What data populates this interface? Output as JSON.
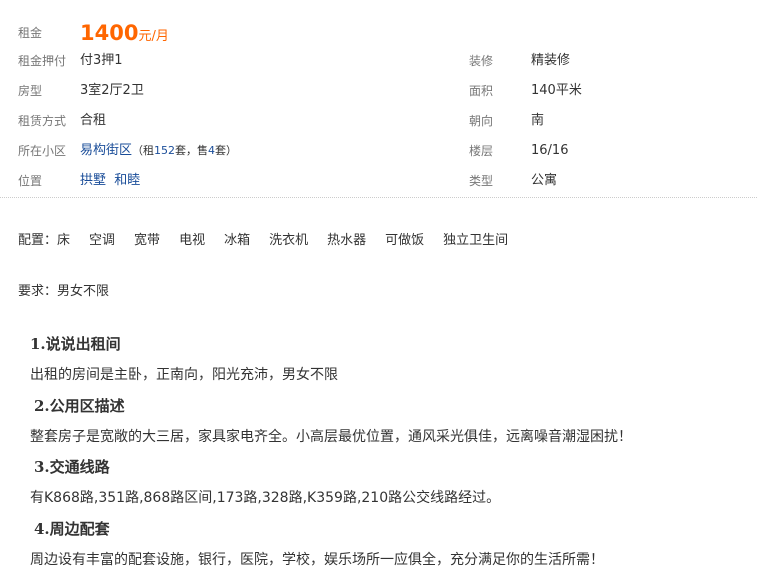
{
  "info": {
    "rent": {
      "label": "租金",
      "amount": "1400",
      "unit": "元/月"
    },
    "deposit": {
      "label": "租金押付",
      "value": "付3押1"
    },
    "decoration": {
      "label": "装修",
      "value": "精装修"
    },
    "layout": {
      "label": "房型",
      "value": "3室2厅2卫"
    },
    "area": {
      "label": "面积",
      "value": "140平米"
    },
    "rent_type": {
      "label": "租赁方式",
      "value": "合租"
    },
    "facing": {
      "label": "朝向",
      "value": "南"
    },
    "community": {
      "label": "所在小区",
      "name": "易构街区",
      "open": "（租",
      "rent_count": "152",
      "mid": "套，售",
      "sale_count": "4",
      "close": "套）"
    },
    "floor": {
      "label": "楼层",
      "value": "16/16"
    },
    "location": {
      "label": "位置",
      "district": "拱墅",
      "area": "和睦"
    },
    "type": {
      "label": "类型",
      "value": "公寓"
    }
  },
  "config": {
    "label": "配置：",
    "items": [
      "床",
      "空调",
      "宽带",
      "电视",
      "冰箱",
      "洗衣机",
      "热水器",
      "可做饭",
      "独立卫生间"
    ]
  },
  "requirement": {
    "text": "要求：男女不限"
  },
  "sections": [
    {
      "title": "1.说说出租间",
      "body": "出租的房间是主卧，正南向，阳光充沛，男女不限"
    },
    {
      "title": "2.公用区描述",
      "body": "整套房子是宽敞的大三居，家具家电齐全。小高层最优位置，通风采光俱佳，远离噪音潮湿困扰！"
    },
    {
      "title": "3.交通线路",
      "body": "有K868路,351路,868路区间,173路,328路,K359路,210路公交线路经过。"
    },
    {
      "title": "4.周边配套",
      "body": "周边设有丰富的配套设施，银行，医院，学校，娱乐场所一应俱全，充分满足你的生活所需！"
    }
  ],
  "colors": {
    "accent": "#ff6600",
    "link": "#1a4d99",
    "label": "#777777"
  }
}
